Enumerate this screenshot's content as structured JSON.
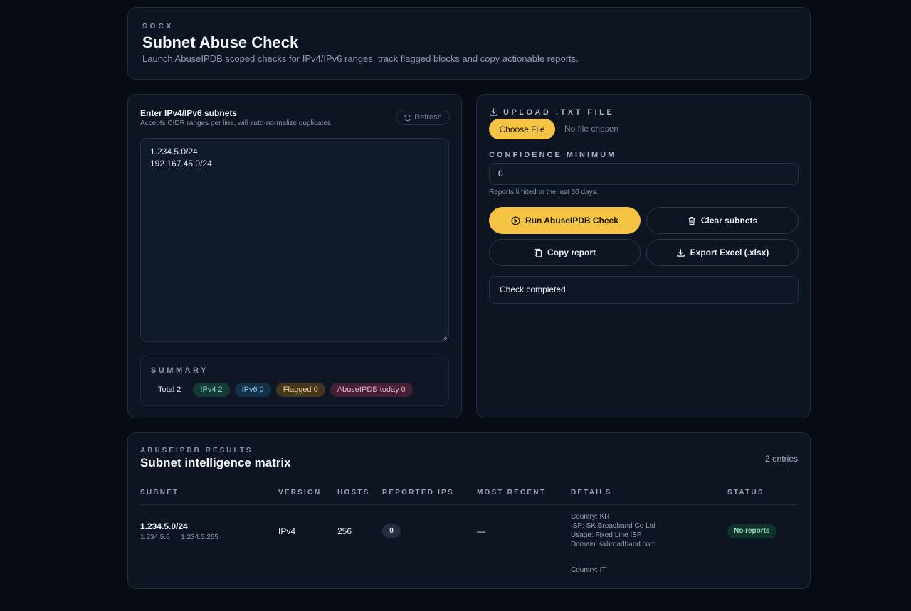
{
  "header": {
    "eyebrow": "SOCX",
    "title": "Subnet Abuse Check",
    "subtitle": "Launch AbuseIPDB scoped checks for IPv4/IPv6 ranges, track flagged blocks and copy actionable reports."
  },
  "input_panel": {
    "label": "Enter IPv4/IPv6 subnets",
    "help": "Accepts CIDR ranges per line, will auto-normalize duplicates.",
    "refresh_label": "Refresh",
    "lines": [
      "1.234.5.0/24",
      "192.167.45.0/24"
    ]
  },
  "summary": {
    "heading": "SUMMARY",
    "total": "Total 2",
    "ipv4": "IPv4 2",
    "ipv6": "IPv6 0",
    "flagged": "Flagged 0",
    "abuseipdb_today": "AbuseIPDB today 0"
  },
  "controls": {
    "upload_heading": "UPLOAD .TXT FILE",
    "choose_file_label": "Choose File",
    "file_status": "No file chosen",
    "confidence_label": "CONFIDENCE MINIMUM",
    "confidence_value": "0",
    "confidence_help": "Reports limited to the last 30 days.",
    "run_label": "Run AbuseIPDB Check",
    "clear_label": "Clear subnets",
    "copy_label": "Copy report",
    "export_label": "Export Excel (.xlsx)",
    "status_message": "Check completed."
  },
  "results": {
    "eyebrow": "ABUSEIPDB RESULTS",
    "title": "Subnet intelligence matrix",
    "entries": "2 entries",
    "columns": [
      "SUBNET",
      "VERSION",
      "HOSTS",
      "REPORTED IPS",
      "MOST RECENT",
      "DETAILS",
      "STATUS"
    ],
    "rows": [
      {
        "subnet": "1.234.5.0/24",
        "range": "1.234.5.0 → 1.234.5.255",
        "version": "IPv4",
        "hosts": "256",
        "reported": "0",
        "most_recent": "—",
        "details": [
          "Country: KR",
          "ISP: SK Broadband Co Ltd",
          "Usage: Fixed Line ISP",
          "Domain: skbroadband.com"
        ],
        "status": "No reports"
      },
      {
        "subnet": "",
        "range": "",
        "version": "",
        "hosts": "",
        "reported": "",
        "most_recent": "",
        "details": [
          "Country: IT"
        ],
        "status": ""
      }
    ]
  },
  "colors": {
    "background": "#070b13",
    "panel": "#0d1422",
    "accent": "#f6c444",
    "ipv4_pill": "#143a35",
    "ipv6_pill": "#13304b",
    "flagged_pill": "#43361c",
    "abuse_pill": "#432033",
    "status_ok": "#113229"
  }
}
